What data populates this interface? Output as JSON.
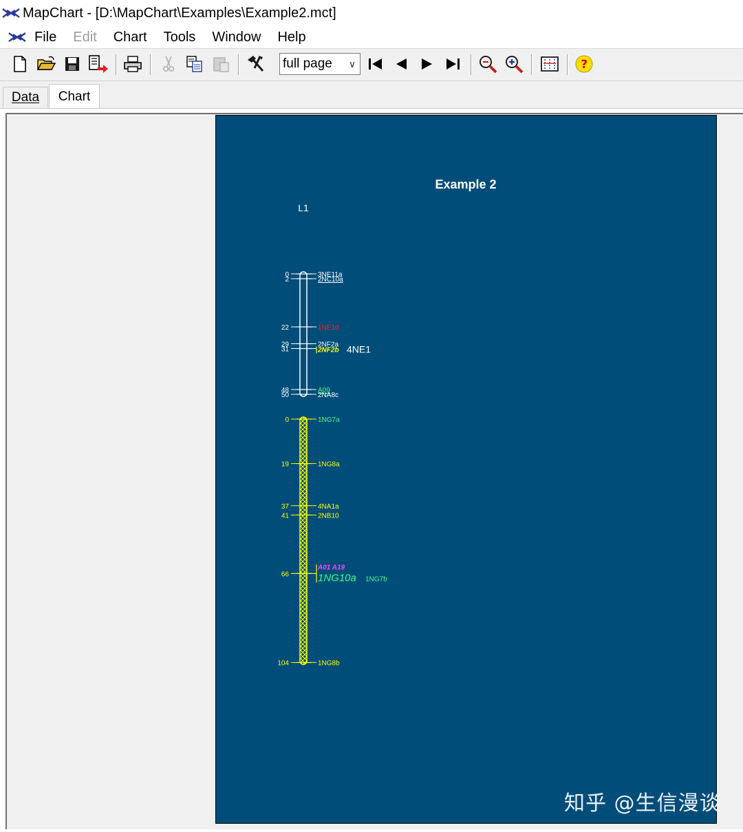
{
  "window": {
    "title": "MapChart - [D:\\MapChart\\Examples\\Example2.mct]",
    "app_icon": "mapchart-icon"
  },
  "menu": {
    "items": [
      {
        "label": "File",
        "enabled": true
      },
      {
        "label": "Edit",
        "enabled": false
      },
      {
        "label": "Chart",
        "enabled": true
      },
      {
        "label": "Tools",
        "enabled": true
      },
      {
        "label": "Window",
        "enabled": true
      },
      {
        "label": "Help",
        "enabled": true
      }
    ]
  },
  "toolbar": {
    "zoom_value": "full page",
    "icons": [
      "new-file-icon",
      "open-folder-icon",
      "save-icon",
      "export-icon",
      "print-icon",
      "cut-icon",
      "copy-icon",
      "paste-icon",
      "tools-icon",
      "first-page-icon",
      "prev-page-icon",
      "next-page-icon",
      "last-page-icon",
      "zoom-out-icon",
      "zoom-in-icon",
      "page-setup-icon",
      "help-icon"
    ]
  },
  "tabs": [
    {
      "label": "Data",
      "active": false
    },
    {
      "label": "Chart",
      "active": true
    }
  ],
  "chart": {
    "title": "Example 2",
    "background": "#004d7a",
    "group_label": "L1",
    "chart_data": [
      {
        "type": "linkage-map",
        "name": "",
        "color": "#ffffff",
        "fill": "none",
        "range": [
          0,
          50
        ],
        "markers": [
          {
            "pos": 0,
            "pos_label": "0",
            "name": "3NE11a",
            "color": "#ffffff"
          },
          {
            "pos": 2,
            "pos_label": "2",
            "name": "2NC10a",
            "color": "#ffffff",
            "underline": true
          },
          {
            "pos": 22,
            "pos_label": "22",
            "name": "1NE1d",
            "color": "#ff2020"
          },
          {
            "pos": 29,
            "pos_label": "29",
            "name": "2NF2a",
            "color": "#ffffff"
          },
          {
            "pos": 31,
            "pos_label": "31",
            "name": "2NF2b",
            "color": "#ffff00",
            "bold_italic": true,
            "group": "4NE1",
            "group_color": "#ffffff"
          },
          {
            "pos": 48,
            "pos_label": "48",
            "name": "A09",
            "color": "#40ff80",
            "underline": true
          },
          {
            "pos": 50,
            "pos_label": "50",
            "name": "2NA8c",
            "color": "#ffffff"
          }
        ]
      },
      {
        "type": "linkage-map",
        "name": "",
        "color": "#ffff00",
        "fill": "crosshatch",
        "range": [
          0,
          104
        ],
        "markers": [
          {
            "pos": 0,
            "pos_label": "0",
            "name": "1NG7a",
            "color": "#40ff80"
          },
          {
            "pos": 19,
            "pos_label": "19",
            "name": "1NG8a",
            "color": "#ffff00"
          },
          {
            "pos": 37,
            "pos_label": "37",
            "name": "4NA1a",
            "color": "#ffff00"
          },
          {
            "pos": 41,
            "pos_label": "41",
            "name": "2NB10",
            "color": "#ffff00"
          },
          {
            "pos": 66,
            "pos_label": "66",
            "name": "A01 A19",
            "color": "#ff40ff",
            "bold_italic": true
          },
          {
            "pos": 66,
            "pos_label": "",
            "name": "1NG10a",
            "color": "#40ff80",
            "large_italic": true,
            "extra": "1NG7b",
            "extra_color": "#40ff80"
          },
          {
            "pos": 104,
            "pos_label": "104",
            "name": "1NG8b",
            "color": "#ffff00"
          }
        ]
      }
    ]
  },
  "watermark": "知乎 @生信漫谈"
}
